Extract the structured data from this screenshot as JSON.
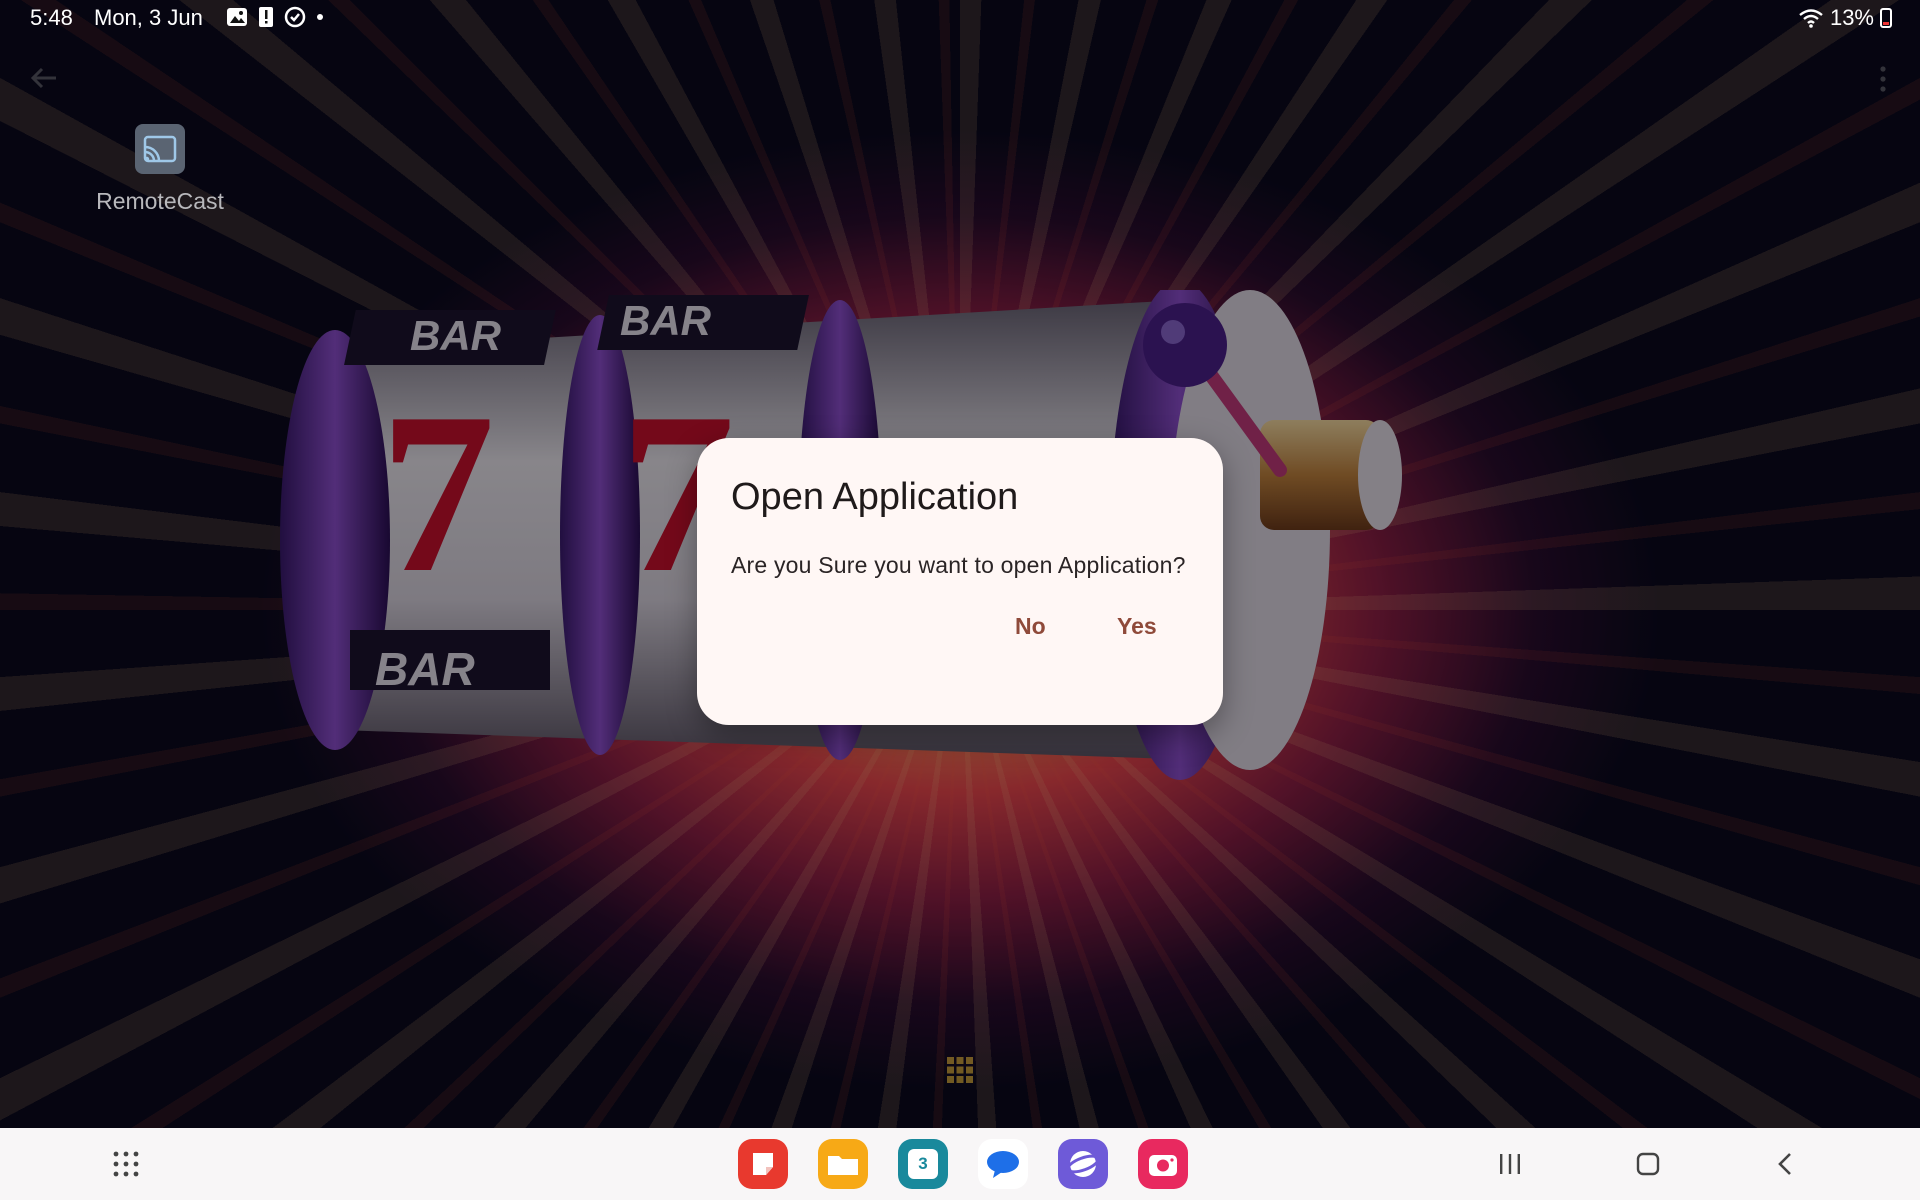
{
  "status_bar": {
    "time": "5:48",
    "date": "Mon, 3 Jun",
    "battery_percent": "13%",
    "notification_icons": [
      "gallery-icon",
      "alert-icon",
      "sync-icon",
      "dot-icon"
    ]
  },
  "app": {
    "shortcut_label": "RemoteCast",
    "shortcut_icon": "cast-icon"
  },
  "dialog": {
    "title": "Open Application",
    "message": "Are you Sure you want to open Application?",
    "no_label": "No",
    "yes_label": "Yes"
  },
  "taskbar": {
    "dock_apps": [
      {
        "name": "notes",
        "icon": "notes-icon",
        "color": "#e8392e"
      },
      {
        "name": "my-files",
        "icon": "folder-icon",
        "color": "#f7a916"
      },
      {
        "name": "calendar",
        "icon": "calendar-icon",
        "color": "#19899c",
        "badge_text": "3"
      },
      {
        "name": "messages",
        "icon": "chat-icon",
        "color": "#ffffff"
      },
      {
        "name": "internet",
        "icon": "browser-icon",
        "color": "#6e5ad8"
      },
      {
        "name": "camera",
        "icon": "camera-icon",
        "color": "#e8295f"
      }
    ]
  },
  "colors": {
    "dialog_bg": "#fff7f5",
    "button_text": "#8f4a3a",
    "navbar_bg": "#f8f6f7"
  }
}
